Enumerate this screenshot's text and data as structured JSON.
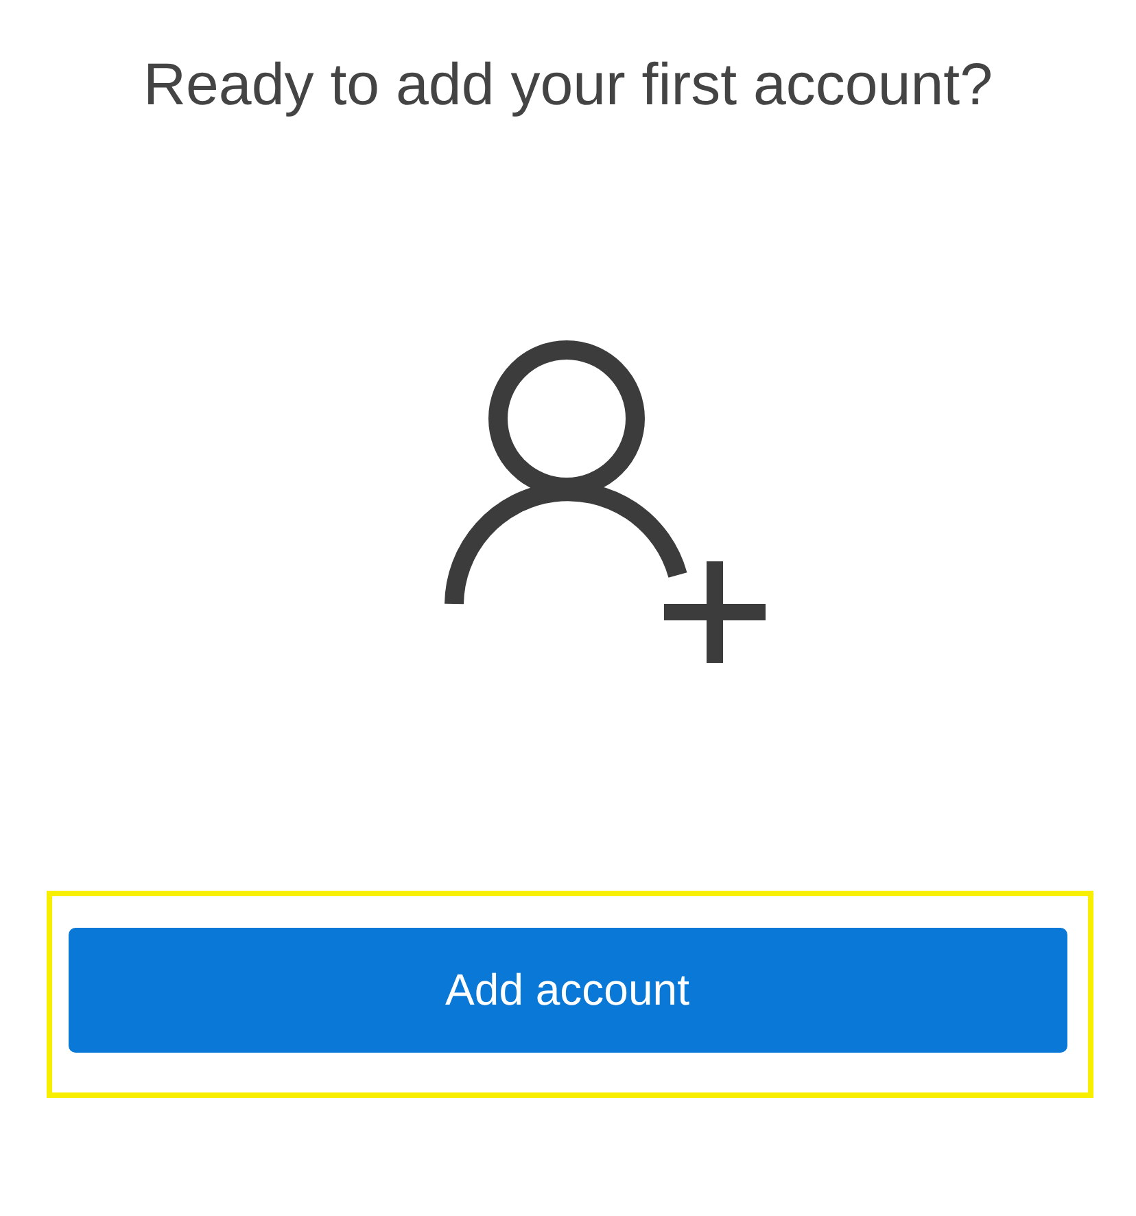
{
  "heading": "Ready to add your first account?",
  "button": {
    "label": "Add account"
  }
}
